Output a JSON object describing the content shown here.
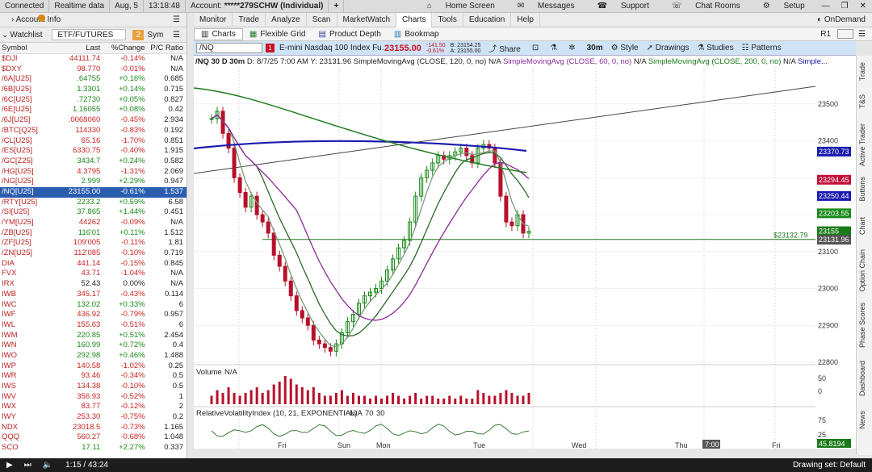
{
  "topbar": {
    "connected": "Connected",
    "realtime": "Realtime data",
    "date": "Aug, 5",
    "time": "13:18:48",
    "account_label": "Account:",
    "account_value": "*****279SCHW (Individual)",
    "home": "Home Screen",
    "messages": "Messages",
    "support": "Support",
    "chatrooms": "Chat Rooms",
    "setup": "Setup"
  },
  "menu": [
    "Monitor",
    "Trade",
    "Analyze",
    "Scan",
    "MarketWatch",
    "Charts",
    "Tools",
    "Education",
    "Help"
  ],
  "ondemand": "OnDemand",
  "left": {
    "account_info": "Account Info",
    "watchlist": "Watchlist",
    "list_name": "ETF/FUTURES",
    "badge": "2",
    "sym_tab": "Sym",
    "columns": [
      "Symbol",
      "Last",
      "%Change",
      "P/C Ratio"
    ],
    "rows": [
      {
        "s": "$DJI",
        "l": "44111.74",
        "c": "-0.14%",
        "r": "N/A"
      },
      {
        "s": "$DXY",
        "l": "98.770",
        "c": "-0.01%",
        "r": "N/A"
      },
      {
        "s": "/6A[U25]",
        "l": ".64755",
        "c": "+0.16%",
        "r": "0.685"
      },
      {
        "s": "/6B[U25]",
        "l": "1.3301",
        "c": "+0.14%",
        "r": "0.715"
      },
      {
        "s": "/6C[U25]",
        "l": ".72730",
        "c": "+0.05%",
        "r": "0.827"
      },
      {
        "s": "/6E[U25]",
        "l": "1.16055",
        "c": "+0.08%",
        "r": "0.42"
      },
      {
        "s": "/6J[U25]",
        "l": ".0068060",
        "c": "-0.45%",
        "r": "2.934"
      },
      {
        "s": "/BTC[Q25]",
        "l": "114330",
        "c": "-0.83%",
        "r": "0.192"
      },
      {
        "s": "/CL[U25]",
        "l": "65.16",
        "c": "-1.70%",
        "r": "0.851"
      },
      {
        "s": "/ES[U25]",
        "l": "6330.75",
        "c": "-0.40%",
        "r": "1.915"
      },
      {
        "s": "/GC[Z25]",
        "l": "3434.7",
        "c": "+0.24%",
        "r": "0.582"
      },
      {
        "s": "/HG[U25]",
        "l": "4.3795",
        "c": "-1.31%",
        "r": "2.069"
      },
      {
        "s": "/NG[U25]",
        "l": "2.999",
        "c": "+2.29%",
        "r": "0.947"
      },
      {
        "s": "/NQ[U25]",
        "l": "23155.00",
        "c": "-0.61%",
        "r": "1.537",
        "sel": true
      },
      {
        "s": "/RTY[U25]",
        "l": "2233.2",
        "c": "+0.59%",
        "r": "6.58"
      },
      {
        "s": "/SI[U25]",
        "l": "37.865",
        "c": "+1.44%",
        "r": "0.451"
      },
      {
        "s": "/YM[U25]",
        "l": "44262",
        "c": "-0.09%",
        "r": "N/A"
      },
      {
        "s": "/ZB[U25]",
        "l": "116'01",
        "c": "+0.11%",
        "r": "1.512"
      },
      {
        "s": "/ZF[U25]",
        "l": "109'005",
        "c": "-0.11%",
        "r": "1.81"
      },
      {
        "s": "/ZN[U25]",
        "l": "112'085",
        "c": "-0.10%",
        "r": "0.719"
      },
      {
        "s": "DIA",
        "l": "441.14",
        "c": "-0.15%",
        "r": "0.845",
        "e": true
      },
      {
        "s": "FVX",
        "l": "43.71",
        "c": "-1.04%",
        "r": "N/A"
      },
      {
        "s": "IRX",
        "l": "52.43",
        "c": "0.00%",
        "r": "N/A"
      },
      {
        "s": "IWB",
        "l": "345.17",
        "c": "-0.43%",
        "r": "0.114",
        "e": true
      },
      {
        "s": "IWC",
        "l": "132.02",
        "c": "+0.33%",
        "r": "6"
      },
      {
        "s": "IWF",
        "l": "436.92",
        "c": "-0.79%",
        "r": "0.957"
      },
      {
        "s": "IWL",
        "l": "155.63",
        "c": "-0.51%",
        "r": "6"
      },
      {
        "s": "IWM",
        "l": "220.85",
        "c": "+0.51%",
        "r": "2.454",
        "e": true
      },
      {
        "s": "IWN",
        "l": "160.99",
        "c": "+0.72%",
        "r": "0.4",
        "e": true
      },
      {
        "s": "IWO",
        "l": "292.98",
        "c": "+0.46%",
        "r": "1.488",
        "e": true
      },
      {
        "s": "IWP",
        "l": "140.58",
        "c": "-1.02%",
        "r": "0.25"
      },
      {
        "s": "IWR",
        "l": "93.46",
        "c": "-0.34%",
        "r": "0.5"
      },
      {
        "s": "IWS",
        "l": "134.38",
        "c": "-0.10%",
        "r": "0.5"
      },
      {
        "s": "IWV",
        "l": "356.93",
        "c": "-0.52%",
        "r": "1",
        "e": true
      },
      {
        "s": "IWX",
        "l": "83.77",
        "c": "-0.12%",
        "r": "2"
      },
      {
        "s": "IWY",
        "l": "253.30",
        "c": "-0.75%",
        "r": "0.2"
      },
      {
        "s": "NDX",
        "l": "23018.5",
        "c": "-0.73%",
        "r": "1.165"
      },
      {
        "s": "QQQ",
        "l": "560.27",
        "c": "-0.68%",
        "r": "1.048",
        "e": true
      },
      {
        "s": "SCO",
        "l": "17.11",
        "c": "+2.27%",
        "r": "0.337"
      }
    ]
  },
  "tabs": [
    "Charts",
    "Flexible Grid",
    "Product Depth",
    "Bookmap"
  ],
  "tab_right": "R1",
  "symbar": {
    "symbol": "/NQ",
    "desc": "E-mini Nasdaq 100 Index Fu...",
    "price": "23155.00",
    "chg1": "-141.50",
    "chg2": "-0.61%",
    "ask": "A: 23155.00",
    "bid": "B: 23154.25",
    "share": "Share",
    "tf": "30m",
    "style": "Style",
    "drawings": "Drawings",
    "studies": "Studies",
    "patterns": "Patterns"
  },
  "chart_header": {
    "title": "/NQ 30 D 30m",
    "d": "D: 8/7/25 7:00 AM",
    "y": "Y: 23131.96",
    "sma120": "SimpleMovingAvg (CLOSE, 120, 0, no)",
    "na1": "N/A",
    "sma60": "SimpleMovingAvg (CLOSE, 60, 0, no)",
    "na2": "N/A",
    "sma200": "SimpleMovingAvg (CLOSE, 200, 0, no)",
    "na3": "N/A",
    "more": "Simple..."
  },
  "colors": {
    "green_line": "#1a7a1a",
    "blue_line": "#1a1ab0",
    "purple_line": "#8a2a9a",
    "candle_red": "#b8102a",
    "candle_green": "#1a8a1a",
    "rvi_line": "#3a7a3a"
  },
  "chart_data": {
    "type": "candlestick",
    "x_labels": [
      "Fri",
      "Sun",
      "Mon",
      "Tue",
      "Wed",
      "Thu",
      "Fri"
    ],
    "y_ticks": [
      22800,
      22900,
      23000,
      23100,
      23200,
      23300,
      23400,
      23500
    ],
    "ylim": [
      22800,
      23600
    ],
    "price_labels": [
      {
        "label": "23370.73",
        "value": 23370.73,
        "color": "#1a1ab0"
      },
      {
        "label": "23294.45",
        "value": 23294.45,
        "color": "#c0103a"
      },
      {
        "label": "23250.44",
        "value": 23250.44,
        "color": "#1a1ab0"
      },
      {
        "label": "23203.55",
        "value": 23203.55,
        "color": "#1a8a1a"
      },
      {
        "label": "23155",
        "value": 23155,
        "color": "#1a7a1a"
      },
      {
        "label": "23131.96",
        "value": 23131.96,
        "color": "#555"
      }
    ],
    "hline": {
      "label": "$23132.79",
      "value": 23132.79
    },
    "hover_label": "7:00",
    "closes": [
      23460,
      23480,
      23420,
      23380,
      23300,
      23260,
      23220,
      23250,
      23200,
      23180,
      23150,
      23090,
      23060,
      23020,
      22980,
      22940,
      22920,
      22900,
      22860,
      22850,
      22840,
      22830,
      22850,
      22880,
      22910,
      22930,
      22960,
      22980,
      22990,
      23000,
      23020,
      23050,
      23080,
      23110,
      23130,
      23180,
      23250,
      23300,
      23320,
      23340,
      23360,
      23350,
      23360,
      23370,
      23380,
      23360,
      23340,
      23380,
      23390,
      23380,
      23340,
      23250,
      23180,
      23170,
      23200,
      23150,
      23155
    ],
    "volume_label": "Volume",
    "volume_na": "N/A",
    "volume_ticks": [
      50,
      0
    ],
    "volume": [
      3,
      5,
      4,
      6,
      4,
      3,
      4,
      5,
      6,
      4,
      5,
      7,
      8,
      10,
      9,
      7,
      6,
      5,
      6,
      4,
      3,
      3,
      4,
      5,
      3,
      4,
      3,
      3,
      2,
      3,
      2,
      3,
      4,
      3,
      2,
      3,
      4,
      2,
      3,
      3,
      2,
      2,
      3,
      2,
      3,
      2,
      2,
      5,
      4,
      3,
      3,
      4,
      5,
      4,
      3,
      3,
      4
    ],
    "rvi_label": "RelativeVolatilityIndex (10, 21, EXPONENTIAL)",
    "rvi_na": "N/A",
    "rvi_levels": [
      "70",
      "30"
    ],
    "rvi_ticks": [
      "75",
      "25"
    ],
    "rvi_value_label": "45.8194"
  },
  "right_tabs": [
    "Trade",
    "T&S",
    "Active Trader",
    "Buttons",
    "Chart",
    "Option Chain",
    "Phase Scores",
    "Dashboard",
    "News"
  ],
  "bottombar": {
    "time": "1:15 / 43:24",
    "right": "Drawing set: Default"
  }
}
